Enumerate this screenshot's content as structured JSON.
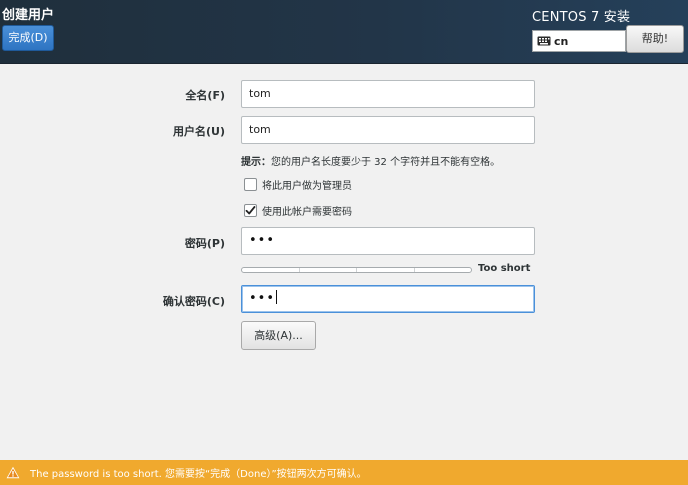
{
  "header": {
    "title": "创建用户",
    "done_label": "完成(D)",
    "product": "CENTOS 7 安装",
    "keyboard_layout": "cn",
    "help_label": "帮助!"
  },
  "form": {
    "fullname": {
      "label": "全名(F)",
      "value": "tom"
    },
    "username": {
      "label": "用户名(U)",
      "value": "tom"
    },
    "hint": {
      "prefix": "提示：",
      "text": "您的用户名长度要少于 32 个字符并且不能有空格。"
    },
    "admin_checkbox": {
      "label": "将此用户做为管理员",
      "checked": false
    },
    "require_password_checkbox": {
      "label": "使用此帐户需要密码",
      "checked": true
    },
    "password": {
      "label": "密码(P)",
      "value": "•••"
    },
    "strength": {
      "text": "Too short",
      "level": 0
    },
    "confirm_password": {
      "label": "确认密码(C)",
      "value": "•••"
    },
    "advanced_label": "高级(A)..."
  },
  "warning": {
    "text": "The password is too short. 您需要按“完成（Done）”按钮两次方可确认。"
  },
  "colors": {
    "header_bg": "#223548",
    "accent": "#4a90d9",
    "warning_bg": "#f0a92e"
  }
}
